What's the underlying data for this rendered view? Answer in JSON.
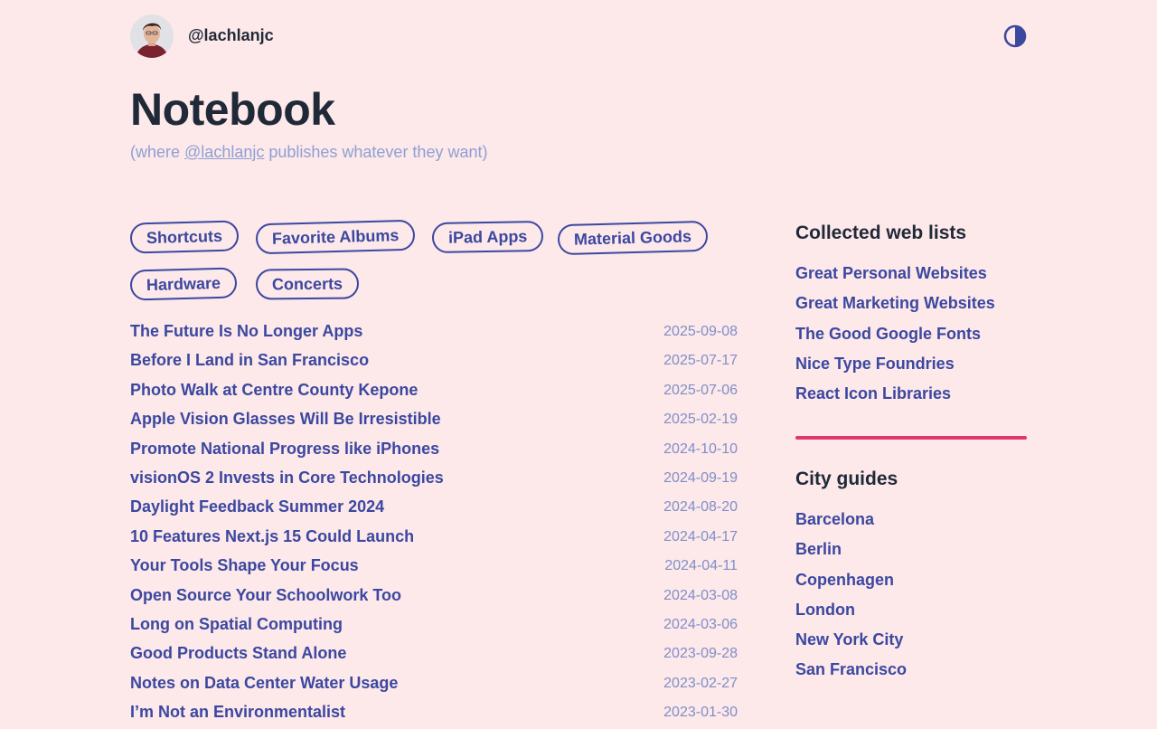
{
  "header": {
    "handle": "@lachlanjc",
    "avatar_icon": "avatar-photo",
    "theme_icon": "contrast-half-circle-icon",
    "accent": "#3b48a0"
  },
  "page": {
    "title": "Notebook",
    "subtitle_prefix": "(where ",
    "subtitle_link": "@lachlanjc",
    "subtitle_suffix": " publishes whatever they want)"
  },
  "tags": [
    "Shortcuts",
    "Favorite Albums",
    "iPad Apps",
    "Material Goods",
    "Hardware",
    "Concerts"
  ],
  "posts": [
    {
      "title": "The Future Is No Longer Apps",
      "date": "2025-09-08"
    },
    {
      "title": "Before I Land in San Francisco",
      "date": "2025-07-17"
    },
    {
      "title": "Photo Walk at Centre County Kepone",
      "date": "2025-07-06"
    },
    {
      "title": "Apple Vision Glasses Will Be Irresistible",
      "date": "2025-02-19"
    },
    {
      "title": "Promote National Progress like iPhones",
      "date": "2024-10-10"
    },
    {
      "title": "visionOS 2 Invests in Core Technologies",
      "date": "2024-09-19"
    },
    {
      "title": "Daylight Feedback Summer 2024",
      "date": "2024-08-20"
    },
    {
      "title": "10 Features Next.js 15 Could Launch",
      "date": "2024-04-17"
    },
    {
      "title": "Your Tools Shape Your Focus",
      "date": "2024-04-11"
    },
    {
      "title": "Open Source Your Schoolwork Too",
      "date": "2024-03-08"
    },
    {
      "title": "Long on Spatial Computing",
      "date": "2024-03-06"
    },
    {
      "title": "Good Products Stand Alone",
      "date": "2023-09-28"
    },
    {
      "title": "Notes on Data Center Water Usage",
      "date": "2023-02-27"
    },
    {
      "title": "I’m Not an Environmentalist",
      "date": "2023-01-30"
    }
  ],
  "sidebar": {
    "web_lists": {
      "heading": "Collected web lists",
      "items": [
        "Great Personal Websites",
        "Great Marketing Websites",
        "The Good Google Fonts",
        "Nice Type Foundries",
        "React Icon Libraries"
      ]
    },
    "divider_color": "#e0356e",
    "city_guides": {
      "heading": "City guides",
      "items": [
        "Barcelona",
        "Berlin",
        "Copenhagen",
        "London",
        "New York City",
        "San Francisco"
      ]
    }
  }
}
